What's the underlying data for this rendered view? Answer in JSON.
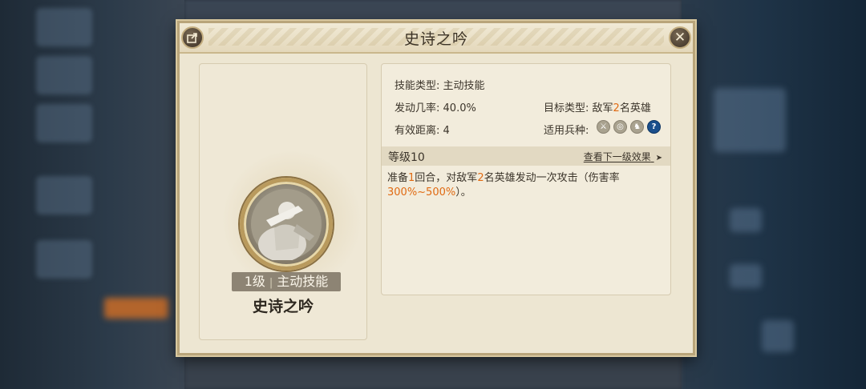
{
  "dialog": {
    "title": "史诗之吟",
    "share_icon": "share-icon",
    "close_icon": "close-icon"
  },
  "skill": {
    "level_badge_level": "1级",
    "level_badge_type": "主动技能",
    "name": "史诗之吟",
    "icon": "warrior-portrait-icon"
  },
  "info": {
    "skill_type_label": "技能类型:",
    "skill_type_value": "主动技能",
    "trigger_rate_label": "发动几率:",
    "trigger_rate_value": "40.0%",
    "range_label": "有效距离:",
    "range_value": "4",
    "target_label": "目标类型:",
    "target_prefix": "敌军",
    "target_count": "2",
    "target_suffix": "名英雄",
    "troop_label": "适用兵种:",
    "troops": [
      "sword-icon",
      "target-icon",
      "horse-icon",
      "question-icon"
    ]
  },
  "level_section": {
    "level": "等级10",
    "next_level_link": "查看下一级效果",
    "next_arrow": "➤"
  },
  "description": {
    "part1": "准备",
    "rounds": "1",
    "part2": "回合，对敌军",
    "targets": "2",
    "part3": "名英雄发动一次攻击（伤害率",
    "damage": "300%~500%",
    "part4": "）。"
  },
  "colors": {
    "highlight": "#e06a12",
    "dialog_bg": "#ede6d2",
    "frame": "#b9a57a"
  }
}
